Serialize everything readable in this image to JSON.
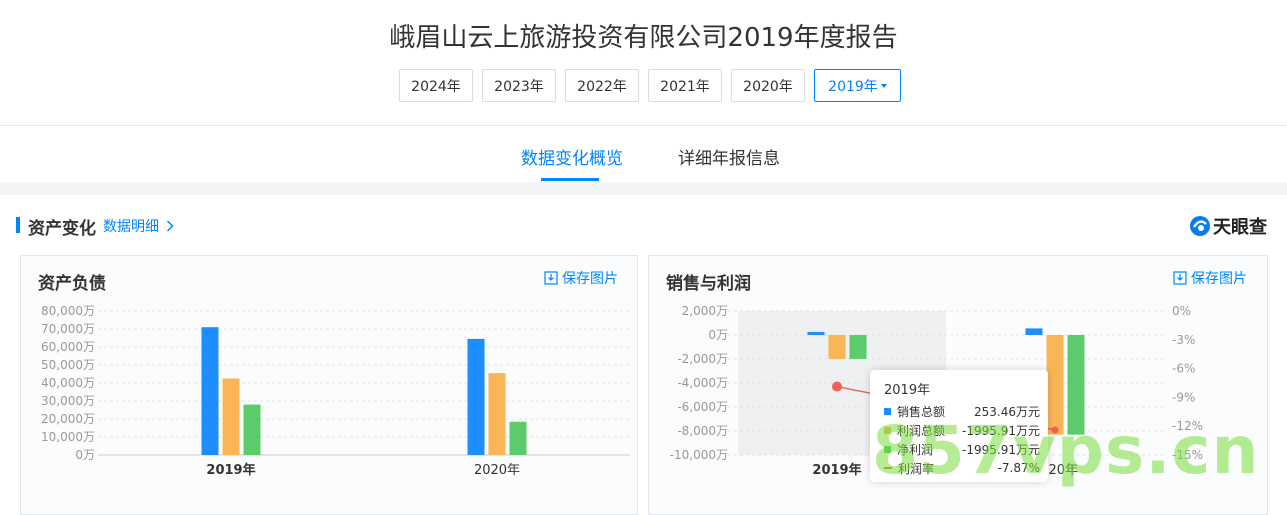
{
  "page_title": "峨眉山云上旅游投资有限公司2019年度报告",
  "years": [
    "2024年",
    "2023年",
    "2022年",
    "2021年",
    "2020年",
    "2019年"
  ],
  "tabs": {
    "overview": "数据变化概览",
    "detail": "详细年报信息"
  },
  "section": {
    "title": "资产变化",
    "link": "数据明细"
  },
  "logo_text": "天眼查",
  "asset_card": {
    "title": "资产负债",
    "save": "保存图片"
  },
  "sales_card": {
    "title": "销售与利润",
    "save": "保存图片"
  },
  "tooltip": {
    "year": "2019年",
    "rows": [
      {
        "label": "销售总额",
        "value": "253.46万元",
        "color": "#1e8eff"
      },
      {
        "label": "利润总额",
        "value": "-1995.91万元",
        "color": "#f5b547"
      },
      {
        "label": "净利润",
        "value": "-1995.91万元",
        "color": "#4cc36a"
      },
      {
        "label": "利润率",
        "value": "-7.87%",
        "color": "#f06155"
      }
    ]
  },
  "watermark": "857vps.cn",
  "colors": {
    "accent": "#0084ff",
    "bar1": "#1e8eff",
    "bar2": "#f9b556",
    "bar3": "#5ccb6a",
    "line": "#f06155"
  },
  "chart_data": [
    {
      "type": "bar",
      "title": "资产负债",
      "categories": [
        "2019年",
        "2020年"
      ],
      "y_ticks": [
        "80,000万",
        "70,000万",
        "60,000万",
        "50,000万",
        "40,000万",
        "30,000万",
        "20,000万",
        "10,000万",
        "0万"
      ],
      "ylim": [
        0,
        80000
      ],
      "series": [
        {
          "values": [
            71000,
            64500
          ],
          "color": "#1e8eff"
        },
        {
          "values": [
            42500,
            45500
          ],
          "color": "#f9b556"
        },
        {
          "values": [
            28000,
            18500
          ],
          "color": "#5ccb6a"
        }
      ]
    },
    {
      "type": "bar",
      "title": "销售与利润",
      "categories": [
        "2019年",
        "2020年"
      ],
      "y_ticks": [
        "2,000万",
        "0万",
        "-2,000万",
        "-4,000万",
        "-6,000万",
        "-8,000万",
        "-10,000万"
      ],
      "y2_ticks": [
        "0%",
        "-3%",
        "-6%",
        "-9%",
        "-12%",
        "-15%"
      ],
      "ylim": [
        -10000,
        2000
      ],
      "y2lim": [
        -15,
        0
      ],
      "series": [
        {
          "name": "销售总额",
          "values": [
            253.46,
            550
          ],
          "color": "#1e8eff"
        },
        {
          "name": "利润总额",
          "values": [
            -1995.91,
            -8300
          ],
          "color": "#f9b556"
        },
        {
          "name": "净利润",
          "values": [
            -1995.91,
            -8300
          ],
          "color": "#5ccb6a"
        },
        {
          "name": "利润率",
          "type": "line",
          "values": [
            -7.87,
            -12.4
          ],
          "color": "#f06155"
        }
      ]
    }
  ]
}
